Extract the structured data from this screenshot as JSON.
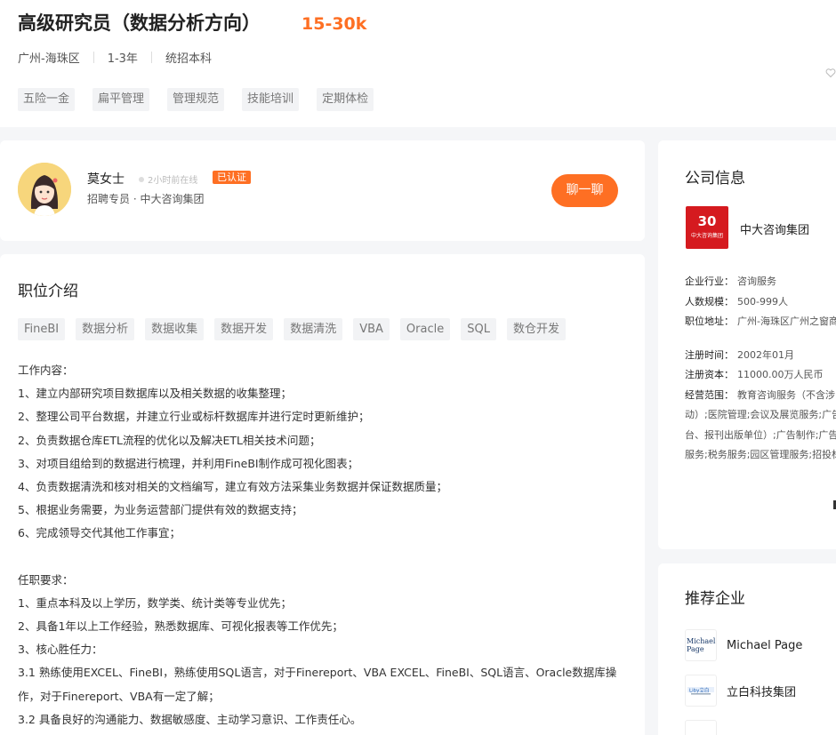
{
  "job": {
    "title": "高级研究员（数据分析方向）",
    "salary": "15-30k",
    "meta": [
      "广州-海珠区",
      "1-3年",
      "统招本科"
    ],
    "welfare": [
      "五险一金",
      "扁平管理",
      "管理规范",
      "技能培训",
      "定期体检"
    ]
  },
  "recruiter": {
    "name": "莫女士",
    "online": "2小时前在线",
    "badge": "已认证",
    "subtitle": "招聘专员 · 中大咨询集团",
    "chat_label": "聊一聊"
  },
  "description": {
    "title": "职位介绍",
    "skills": [
      "FineBI",
      "数据分析",
      "数据收集",
      "数据开发",
      "数据清洗",
      "VBA",
      "Oracle",
      "SQL",
      "数仓开发"
    ],
    "lines": [
      "工作内容：",
      "1、建立内部研究项目数据库以及相关数据的收集整理；",
      "2、整理公司平台数据，并建立行业或标杆数据库并进行定时更新维护；",
      "2、负责数据仓库ETL流程的优化以及解决ETL相关技术问题；",
      "3、对项目组给到的数据进行梳理，并利用FineBI制作成可视化图表；",
      "4、负责数据清洗和核对相关的文档编写，建立有效方法采集业务数据并保证数据质量；",
      "5、根据业务需要，为业务运营部门提供有效的数据支持；",
      "6、完成领导交代其他工作事宜；",
      "",
      "任职要求：",
      "1、重点本科及以上学历，数学类、统计类等专业优先；",
      "2、具备1年以上工作经验，熟悉数据库、可视化报表等工作优先；",
      "3、核心胜任力：",
      "3.1 熟练使用EXCEL、FineBI，熟练使用SQL语言，对于Finereport、VBA EXCEL、FineBI、SQL语言、Oracle数据库操",
      "作，对于Finereport、VBA有一定了解；",
      "3.2 具备良好的沟通能力、数据敏感度、主动学习意识、工作责任心。"
    ]
  },
  "company": {
    "section_title": "公司信息",
    "logo_text": "30",
    "logo_sub": "中大咨询集团",
    "name": "中大咨询集团",
    "industry_label": "企业行业：",
    "industry": "咨询服务",
    "size_label": "人数规模：",
    "size": "500-999人",
    "address_label": "职位地址：",
    "address": "广州-海珠区广州之窗商",
    "reg_time_label": "注册时间：",
    "reg_time": "2002年01月",
    "capital_label": "注册资本：",
    "capital": "11000.00万人民币",
    "scope_label": "经营范围：",
    "scope": "教育咨询服务（不含涉",
    "scope_lines": [
      "动）;医院管理;会议及展览服务;广告",
      "台、报刊出版单位）;广告制作;广告",
      "服务;税务服务;园区管理服务;招投标"
    ]
  },
  "recommend": {
    "title": "推荐企业",
    "items": [
      {
        "name": "Michael Page",
        "logo": "Michael Page"
      },
      {
        "name": "立白科技集团",
        "logo": "立白"
      }
    ]
  }
}
